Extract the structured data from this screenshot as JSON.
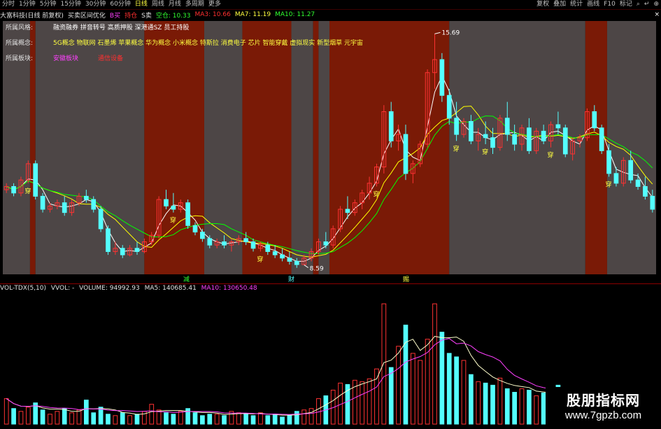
{
  "toolbar": {
    "periods": [
      "分时",
      "1分钟",
      "5分钟",
      "15分钟",
      "30分钟",
      "60分钟",
      "日线",
      "周线",
      "月线",
      "多周期",
      "更多"
    ],
    "active_index": 6,
    "right_items": [
      "复权",
      "叠加",
      "统计",
      "画线",
      "F10",
      "标记"
    ],
    "right_icons": [
      "search-icon",
      "arrow-icon",
      "zoom-icon"
    ]
  },
  "info": {
    "stock": "大富科技(日线 前复权)",
    "indicator": "买卖区间优化",
    "b_label": "B买",
    "hold_label": "持仓",
    "s_label": "S卖",
    "empty_label": "空仓: 10.33",
    "ma3": "MA3: 10.66",
    "ma7": "MA7: 11.19",
    "ma10": "MA10: 11.27",
    "close": "×"
  },
  "attributes": [
    {
      "key": "所属风格:",
      "value": "融资融券 拼音转号 高质押股 深港通SZ 员工持股",
      "color": "#ffffff"
    },
    {
      "key": "所属概念:",
      "value": "5G概念 物联网 石墨烯 苹果概念 华为概念 小米概念 特斯拉 消费电子 芯片 智能穿戴 虚拟现实 新型烟草 元宇宙",
      "color": "#ffff40"
    },
    {
      "key": "所属板块:",
      "value": "安徽板块",
      "value2": "通信设备",
      "color": "#ff40ff",
      "color2": "#ff3030"
    }
  ],
  "annotations": {
    "high": "15.69",
    "low": "8.59",
    "chuan": "穿"
  },
  "mid_labels": [
    "减",
    "财",
    "赐"
  ],
  "sub": {
    "title": "VOL-TDX(5,10)",
    "vvol": "VVOL: -",
    "volume": "VOLUME: 94992.93",
    "ma5": "MA5: 140685.41",
    "ma10": "MA10: 130650.48"
  },
  "watermark": {
    "line1": "股朋指标网",
    "line2": "www.7gpzb.com"
  },
  "colors": {
    "up": "#ff3232",
    "down": "#54ffff",
    "ma3": "#ffffff",
    "ma7": "#ffff00",
    "ma10": "#00ff00",
    "zone_red": "#7a1a06",
    "zone_gray": "#4d4646",
    "vma5": "#ffffcc",
    "vma10": "#ff40ff"
  },
  "chart_data": {
    "type": "candlestick",
    "price_range": [
      8.3,
      16.0
    ],
    "ohlc": [
      [
        10.9,
        11.1,
        10.8,
        11.0
      ],
      [
        11.0,
        11.1,
        10.7,
        10.8
      ],
      [
        10.8,
        11.3,
        10.7,
        11.2
      ],
      [
        11.2,
        11.8,
        11.1,
        11.7
      ],
      [
        11.7,
        11.8,
        10.6,
        10.7
      ],
      [
        10.7,
        10.8,
        10.2,
        10.3
      ],
      [
        10.3,
        10.5,
        10.2,
        10.4
      ],
      [
        10.4,
        10.6,
        10.3,
        10.5
      ],
      [
        10.5,
        10.7,
        10.1,
        10.2
      ],
      [
        10.2,
        10.6,
        10.1,
        10.5
      ],
      [
        10.5,
        10.8,
        10.4,
        10.7
      ],
      [
        10.7,
        10.9,
        10.5,
        10.6
      ],
      [
        10.6,
        10.7,
        10.2,
        10.3
      ],
      [
        10.3,
        10.4,
        9.6,
        9.7
      ],
      [
        9.7,
        9.8,
        8.9,
        9.0
      ],
      [
        9.0,
        9.3,
        8.9,
        9.1
      ],
      [
        9.1,
        9.2,
        8.8,
        8.9
      ],
      [
        8.9,
        9.2,
        8.85,
        9.1
      ],
      [
        9.1,
        9.3,
        8.9,
        9.0
      ],
      [
        9.0,
        9.4,
        8.95,
        9.3
      ],
      [
        9.3,
        9.6,
        9.2,
        9.5
      ],
      [
        9.5,
        10.7,
        9.4,
        10.6
      ],
      [
        10.6,
        10.9,
        10.3,
        10.4
      ],
      [
        10.4,
        10.8,
        10.2,
        10.3
      ],
      [
        10.3,
        10.6,
        10.2,
        10.5
      ],
      [
        10.5,
        10.6,
        9.7,
        9.8
      ],
      [
        9.8,
        9.9,
        9.5,
        9.6
      ],
      [
        9.6,
        9.7,
        9.3,
        9.4
      ],
      [
        9.4,
        9.5,
        9.1,
        9.2
      ],
      [
        9.2,
        9.4,
        9.1,
        9.3
      ],
      [
        9.3,
        9.5,
        9.1,
        9.2
      ],
      [
        9.2,
        9.4,
        9.0,
        9.3
      ],
      [
        9.3,
        9.5,
        9.2,
        9.4
      ],
      [
        9.4,
        9.6,
        9.2,
        9.3
      ],
      [
        9.3,
        9.4,
        9.0,
        9.1
      ],
      [
        9.1,
        9.3,
        9.0,
        9.2
      ],
      [
        9.2,
        9.3,
        8.9,
        9.0
      ],
      [
        9.0,
        9.2,
        8.8,
        8.9
      ],
      [
        8.9,
        9.1,
        8.7,
        8.8
      ],
      [
        8.8,
        9.0,
        8.6,
        8.7
      ],
      [
        8.7,
        8.8,
        8.5,
        8.6
      ],
      [
        8.6,
        8.9,
        8.59,
        8.8
      ],
      [
        8.8,
        9.1,
        8.7,
        9.0
      ],
      [
        9.0,
        9.4,
        8.9,
        9.3
      ],
      [
        9.3,
        9.6,
        9.1,
        9.2
      ],
      [
        9.2,
        9.8,
        9.1,
        9.7
      ],
      [
        9.7,
        10.4,
        9.6,
        10.3
      ],
      [
        10.3,
        10.7,
        10.0,
        10.2
      ],
      [
        10.2,
        10.6,
        10.1,
        10.5
      ],
      [
        10.5,
        10.9,
        10.3,
        10.8
      ],
      [
        10.8,
        11.3,
        10.6,
        11.1
      ],
      [
        11.1,
        11.7,
        11.0,
        11.6
      ],
      [
        11.6,
        13.5,
        11.4,
        13.3
      ],
      [
        13.3,
        13.6,
        12.2,
        12.4
      ],
      [
        12.4,
        12.9,
        12.1,
        12.6
      ],
      [
        12.6,
        12.9,
        11.2,
        11.4
      ],
      [
        11.4,
        11.8,
        11.1,
        11.7
      ],
      [
        11.7,
        12.4,
        11.6,
        12.3
      ],
      [
        12.3,
        14.6,
        12.2,
        14.5
      ],
      [
        14.5,
        15.69,
        14.0,
        14.9
      ],
      [
        14.9,
        15.1,
        13.6,
        13.8
      ],
      [
        13.8,
        14.0,
        12.9,
        13.1
      ],
      [
        13.1,
        13.6,
        12.4,
        12.6
      ],
      [
        12.6,
        13.1,
        12.5,
        13.0
      ],
      [
        13.0,
        13.2,
        12.3,
        12.4
      ],
      [
        12.4,
        12.8,
        12.1,
        12.6
      ],
      [
        12.6,
        13.0,
        12.3,
        12.5
      ],
      [
        12.5,
        12.8,
        12.0,
        12.2
      ],
      [
        12.2,
        13.2,
        12.1,
        13.1
      ],
      [
        13.1,
        13.6,
        12.4,
        12.6
      ],
      [
        12.6,
        12.9,
        12.1,
        12.3
      ],
      [
        12.3,
        12.9,
        12.1,
        12.8
      ],
      [
        12.8,
        13.1,
        12.0,
        12.1
      ],
      [
        12.1,
        12.8,
        12.0,
        12.7
      ],
      [
        12.7,
        12.9,
        12.3,
        12.4
      ],
      [
        12.4,
        13.0,
        12.2,
        12.9
      ],
      [
        12.9,
        13.3,
        12.6,
        12.8
      ],
      [
        12.8,
        12.9,
        11.9,
        12.0
      ],
      [
        12.0,
        12.5,
        11.8,
        12.4
      ],
      [
        12.4,
        12.6,
        12.2,
        12.5
      ],
      [
        12.5,
        13.4,
        12.4,
        13.3
      ],
      [
        13.3,
        13.5,
        12.7,
        12.8
      ],
      [
        12.8,
        12.9,
        12.0,
        12.1
      ],
      [
        12.1,
        12.3,
        11.3,
        11.4
      ],
      [
        11.4,
        11.6,
        11.0,
        11.1
      ],
      [
        11.1,
        11.9,
        11.0,
        11.8
      ],
      [
        11.8,
        12.1,
        11.1,
        11.2
      ],
      [
        11.2,
        11.4,
        10.9,
        11.0
      ],
      [
        11.0,
        11.3,
        10.6,
        10.7
      ],
      [
        10.7,
        10.9,
        10.2,
        10.3
      ]
    ],
    "volume": [
      36,
      22,
      18,
      24,
      30,
      20,
      14,
      18,
      22,
      16,
      20,
      34,
      16,
      24,
      14,
      12,
      16,
      12,
      14,
      18,
      28,
      20,
      16,
      14,
      18,
      22,
      16,
      12,
      14,
      14,
      12,
      18,
      16,
      14,
      12,
      16,
      12,
      14,
      10,
      12,
      18,
      20,
      22,
      36,
      40,
      48,
      58,
      56,
      62,
      60,
      64,
      78,
      170,
      80,
      110,
      140,
      100,
      90,
      120,
      170,
      130,
      100,
      95,
      90,
      70,
      60,
      58,
      55,
      65,
      50,
      45,
      50,
      48,
      40,
      44,
      40,
      55,
      45,
      30,
      38,
      40,
      36,
      35,
      30,
      28,
      32,
      25,
      22,
      20,
      16
    ]
  }
}
